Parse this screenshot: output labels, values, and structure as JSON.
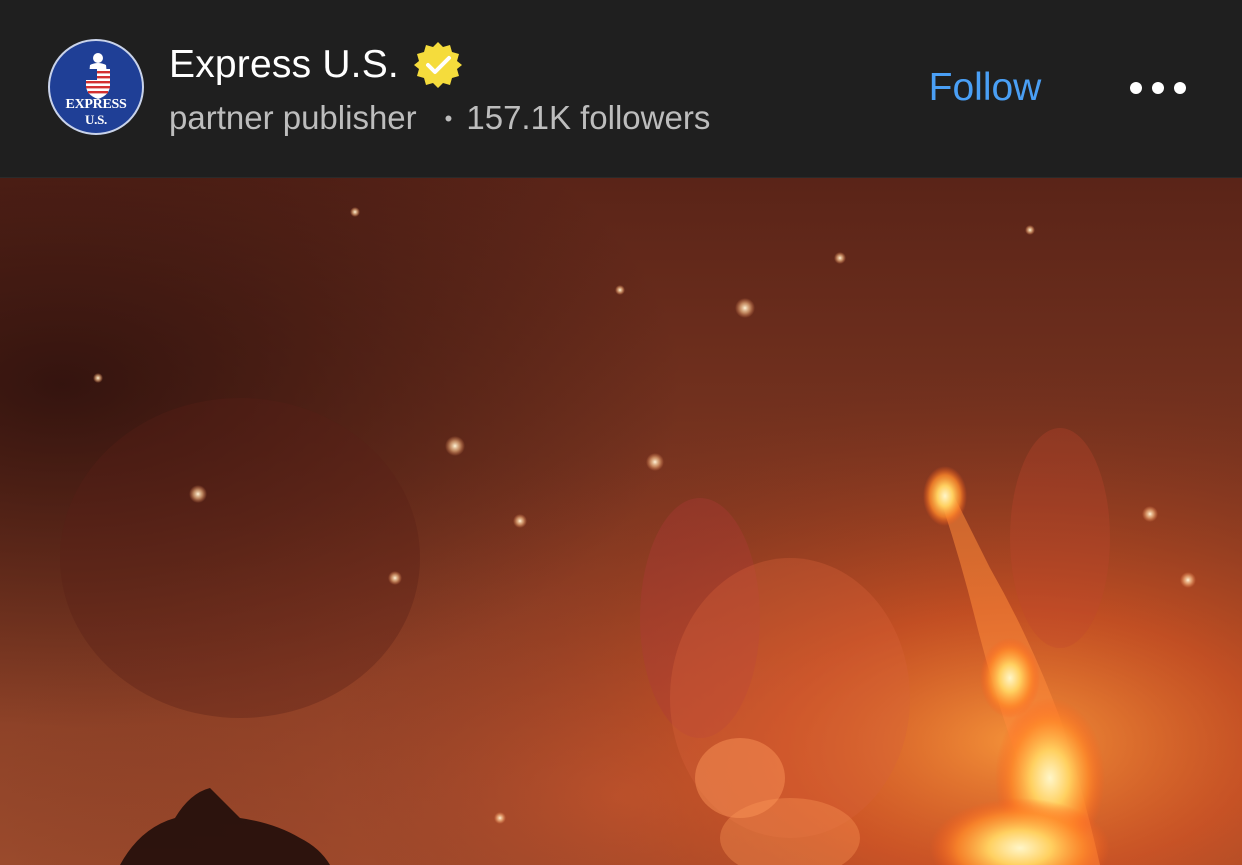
{
  "post_header": {
    "avatar": {
      "line1": "EXPRESS",
      "line2": "U.S."
    },
    "publisher_name": "Express U.S.",
    "verified_icon": "verified-badge-icon",
    "publisher_type": "partner publisher",
    "separator": "•",
    "followers": "157.1K followers",
    "follow_label": "Follow",
    "more_icon": "more-options-icon"
  },
  "media": {
    "subject": "night-fire-photo"
  },
  "colors": {
    "header_background": "#1f1f1f",
    "follow_blue": "#4a9ff5",
    "verified_yellow": "#f5dc3c",
    "avatar_blue": "#1f3f96"
  }
}
